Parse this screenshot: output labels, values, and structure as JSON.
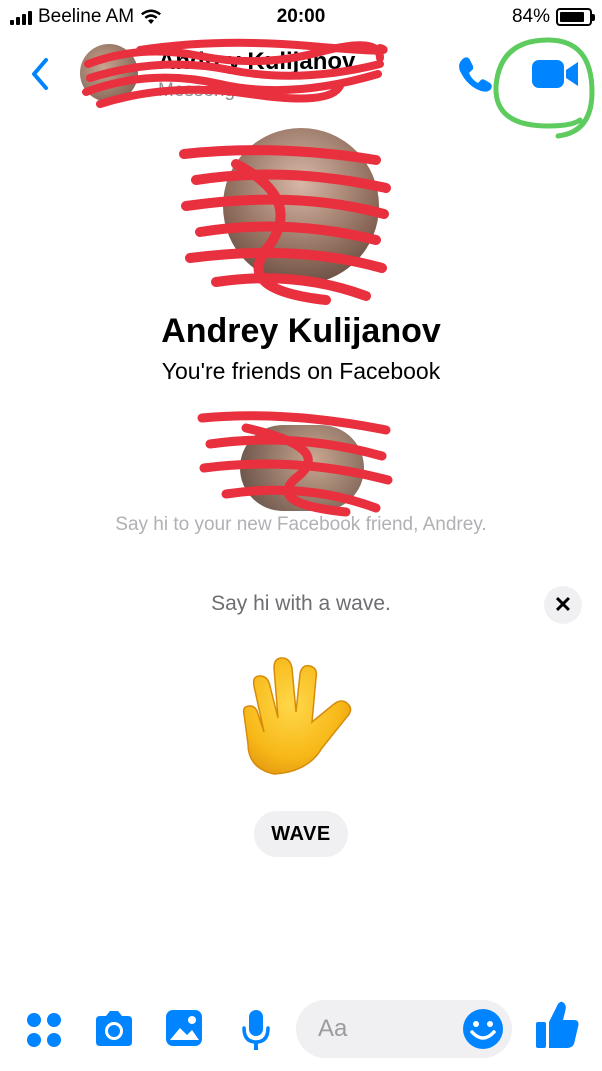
{
  "status_bar": {
    "carrier": "Beeline AM",
    "time": "20:00",
    "battery_percent": "84%",
    "battery_level": 0.84
  },
  "header": {
    "title": "Andrey Kulijanov",
    "subtitle": "Messenger",
    "accent_color": "#0084ff",
    "highlight_color": "#5ecb5e",
    "redaction_color": "#e8303f"
  },
  "profile": {
    "name": "Andrey Kulijanov",
    "relation": "You're friends on Facebook"
  },
  "intro": {
    "say_hi_text": "Say hi to your new Facebook friend, Andrey."
  },
  "wave_card": {
    "prompt": "Say hi with a wave.",
    "close_label": "✕",
    "button_label": "WAVE",
    "hand_emoji_name": "waving-hand-icon"
  },
  "composer": {
    "placeholder": "Aa"
  }
}
